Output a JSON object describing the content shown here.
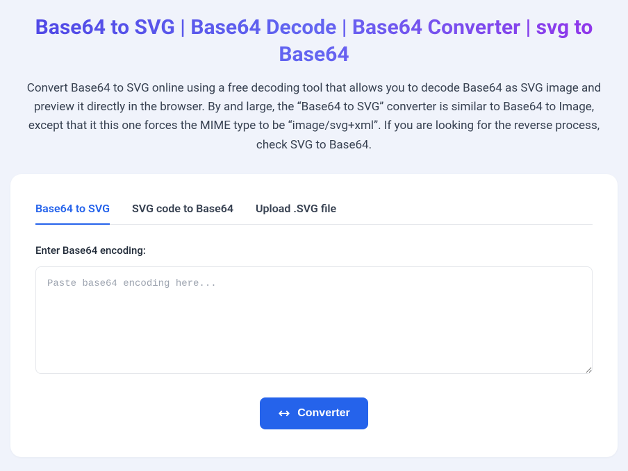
{
  "header": {
    "title": "Base64 to SVG | Base64 Decode | Base64 Converter | svg to Base64",
    "description": "Convert Base64 to SVG online using a free decoding tool that allows you to decode Base64 as SVG image and preview it directly in the browser. By and large, the “Base64 to SVG” converter is similar to Base64 to Image, except that it this one forces the MIME type to be “image/svg+xml”. If you are looking for the reverse process, check SVG to Base64."
  },
  "tabs": [
    {
      "label": "Base64 to SVG",
      "active": true
    },
    {
      "label": "SVG code to Base64",
      "active": false
    },
    {
      "label": "Upload .SVG file",
      "active": false
    }
  ],
  "form": {
    "label": "Enter Base64 encoding:",
    "placeholder": "Paste base64 encoding here...",
    "value": ""
  },
  "actions": {
    "convert_label": "Converter"
  }
}
